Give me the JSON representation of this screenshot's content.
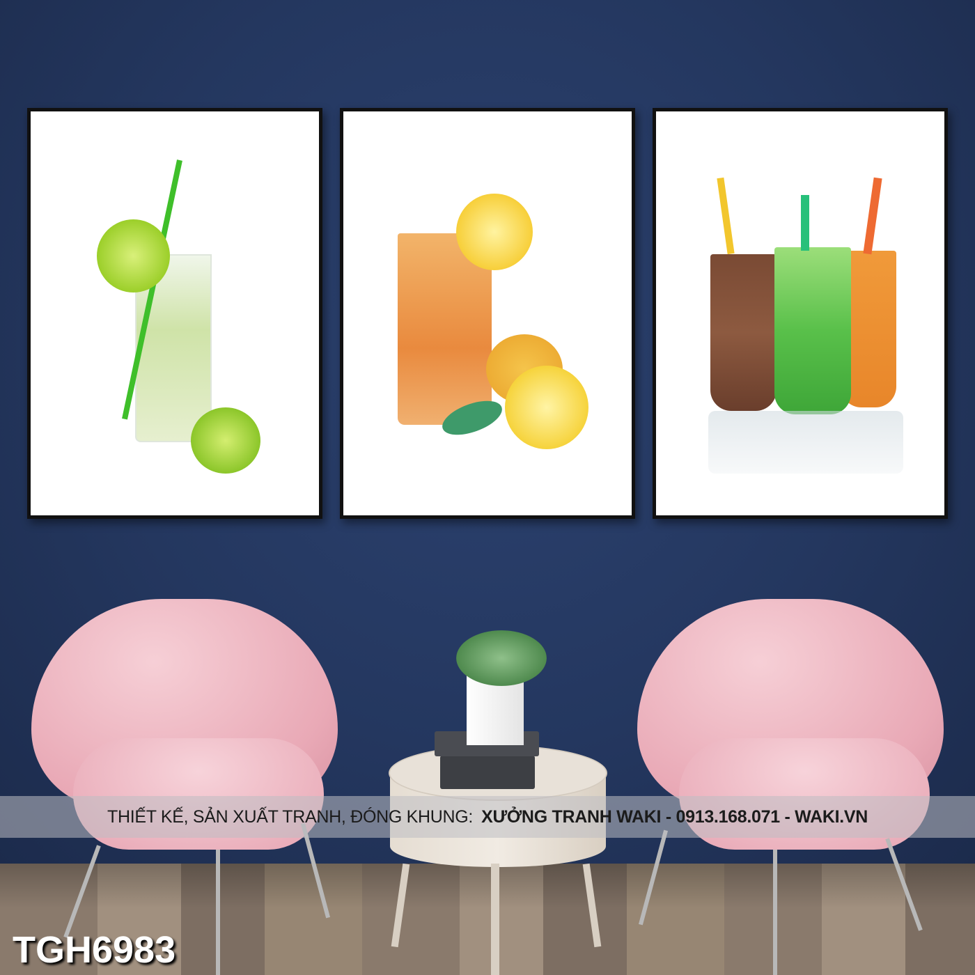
{
  "banner": {
    "prefix": "THIẾT KẾ, SẢN XUẤT TRANH, ĐÓNG KHUNG:",
    "brand": "XƯỞNG TRANH WAKI - 0913.168.071  -  WAKI.VN"
  },
  "product_code": "TGH6983",
  "colors": {
    "wall": "#24375f",
    "chair": "#eab0bc",
    "frame": "#111111"
  }
}
